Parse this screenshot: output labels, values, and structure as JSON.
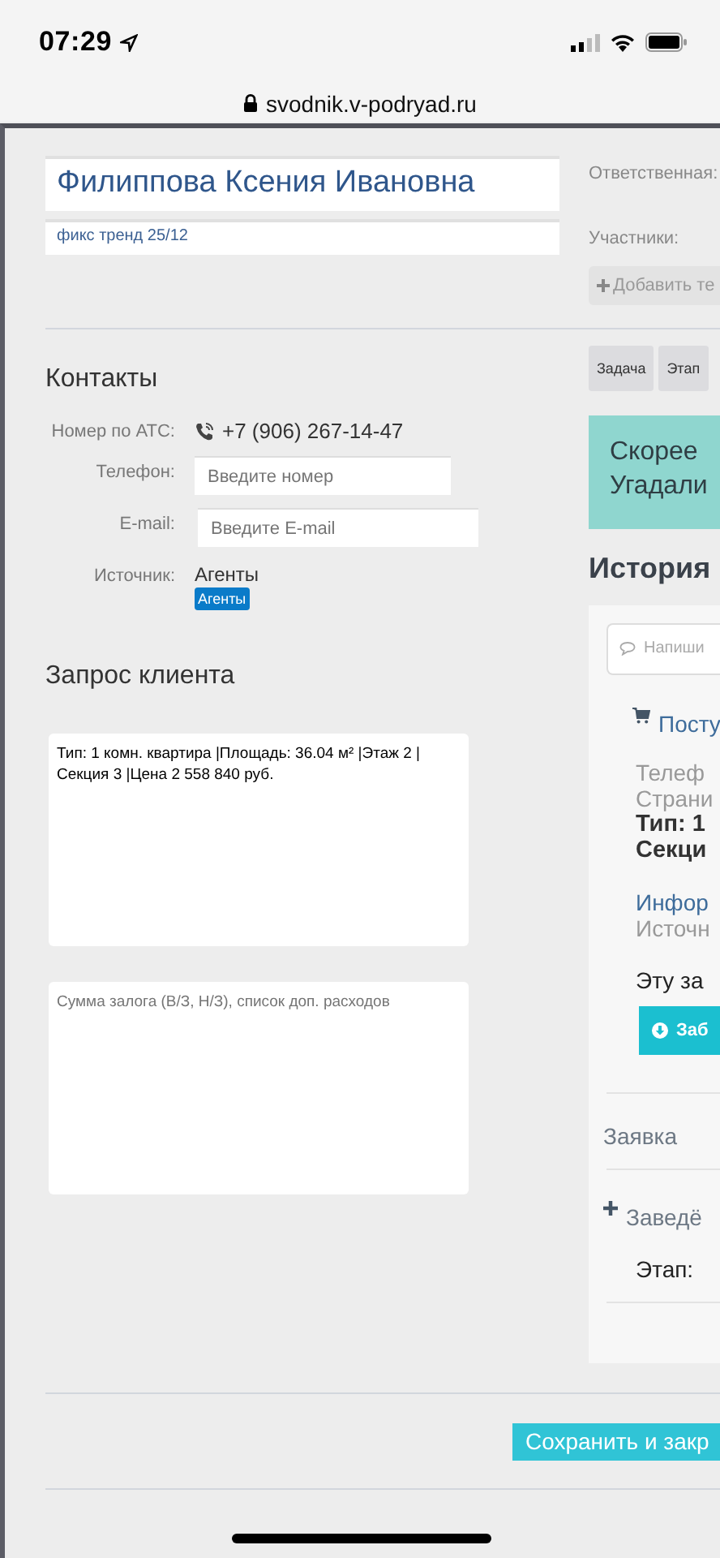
{
  "status_bar": {
    "time": "07:29"
  },
  "browser": {
    "url": "svodnik.v-podryad.ru"
  },
  "client": {
    "name": "Филиппова Ксения Ивановна",
    "note": "фикс тренд 25/12"
  },
  "assignment": {
    "responsible_label": "Ответственная:",
    "participants_label": "Участники:",
    "add_button": "Добавить те"
  },
  "contacts": {
    "title": "Контакты",
    "rows": [
      {
        "kind": "phone",
        "label": "Номер по АТС:",
        "value": "+7 (906) 267-14-47"
      },
      {
        "kind": "input",
        "label": "Телефон:",
        "placeholder": "Введите номер"
      },
      {
        "kind": "input",
        "label": "E-mail:",
        "placeholder": "Введите E-mail"
      },
      {
        "kind": "source",
        "label": "Источник:",
        "value": "Агенты",
        "tag": "Агенты"
      }
    ]
  },
  "request": {
    "title": "Запрос клиента",
    "text": "Тип: 1 комн. квартира |Площадь: 36.04 м² |Этаж 2 | Секция 3 |Цена 2 558 840 руб.",
    "placeholder": "Сумма залога (В/З, Н/З), список доп. расходов"
  },
  "tabs": [
    {
      "label": "Задача"
    },
    {
      "label": "Этап"
    }
  ],
  "notice": {
    "lines": [
      "Скорее",
      "Угадали"
    ]
  },
  "history": {
    "title": "История",
    "comment_placeholder": "Напиши",
    "entries": [
      {
        "blocks": [
          {
            "kind": "cart_title",
            "text": "Посту"
          },
          {
            "kind": "muted",
            "text": "Телеф"
          },
          {
            "kind": "muted",
            "text": "Страни"
          },
          {
            "kind": "strong",
            "text": "Тип: 1"
          },
          {
            "kind": "strong",
            "text": "Секци"
          },
          {
            "kind": "link",
            "text": "Инфор"
          },
          {
            "kind": "muted",
            "text": "Источн"
          },
          {
            "kind": "dark",
            "text": "Эту за"
          },
          {
            "kind": "button",
            "text": "Заб"
          }
        ]
      },
      {
        "blocks": [
          {
            "kind": "title",
            "text": "Заявка"
          }
        ]
      },
      {
        "blocks": [
          {
            "kind": "plus_title",
            "text": "Заведё"
          },
          {
            "kind": "dark",
            "text": "Этап:"
          }
        ]
      }
    ]
  },
  "save_button": "Сохранить и закр"
}
